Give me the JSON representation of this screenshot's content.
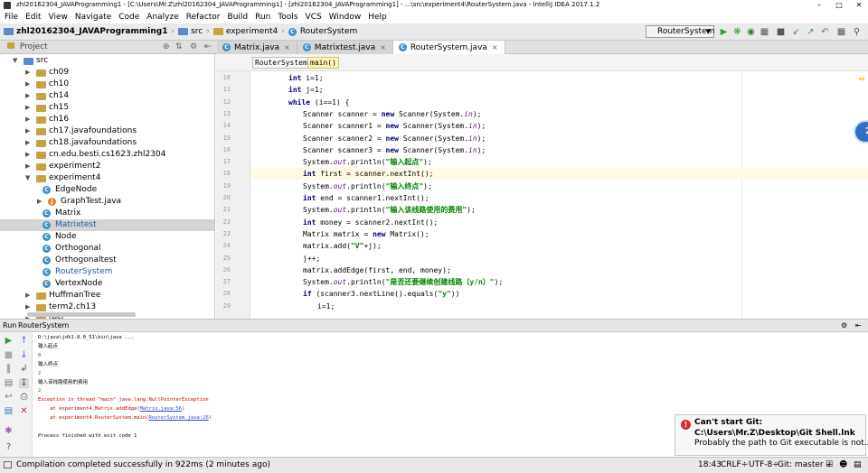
{
  "window": {
    "title": "zhl20162304_JAVAProgramming1 - [C:\\Users\\Mr.Z\\zhl20162304_JAVAProgramming1] - [zhl20162304_JAVAProgramming1] - ...\\src\\experiment4\\RouterSystem.java - IntelliJ IDEA 2017.1.2"
  },
  "menu": [
    "File",
    "Edit",
    "View",
    "Navigate",
    "Code",
    "Analyze",
    "Refactor",
    "Build",
    "Run",
    "Tools",
    "VCS",
    "Window",
    "Help"
  ],
  "breadcrumb": {
    "project": "zhl20162304_JAVAProgramming1",
    "src": "src",
    "pkg": "experiment4",
    "file": "RouterSystem"
  },
  "run_config": "RouterSystem",
  "project_panel": {
    "header": "Project",
    "tree": [
      {
        "label": "src",
        "level": 0,
        "expanded": true,
        "kind": "folder"
      },
      {
        "label": "ch09",
        "level": 1,
        "expanded": false,
        "kind": "folder"
      },
      {
        "label": "ch10",
        "level": 1,
        "expanded": false,
        "kind": "folder"
      },
      {
        "label": "ch14",
        "level": 1,
        "expanded": false,
        "kind": "folder"
      },
      {
        "label": "ch15",
        "level": 1,
        "expanded": false,
        "kind": "folder"
      },
      {
        "label": "ch16",
        "level": 1,
        "expanded": false,
        "kind": "folder"
      },
      {
        "label": "ch17.javafoundations",
        "level": 1,
        "expanded": false,
        "kind": "folder"
      },
      {
        "label": "ch18.javafoundations",
        "level": 1,
        "expanded": false,
        "kind": "folder"
      },
      {
        "label": "cn.edu.besti.cs1623.zhl2304",
        "level": 1,
        "expanded": false,
        "kind": "folder"
      },
      {
        "label": "experiment2",
        "level": 1,
        "expanded": false,
        "kind": "folder"
      },
      {
        "label": "experiment4",
        "level": 1,
        "expanded": true,
        "kind": "folder"
      },
      {
        "label": "EdgeNode",
        "level": 2,
        "kind": "class"
      },
      {
        "label": "GraphTest.java",
        "level": 2,
        "kind": "java",
        "collapsible": true
      },
      {
        "label": "Matrix",
        "level": 2,
        "kind": "class"
      },
      {
        "label": "Matrixtest",
        "level": 2,
        "kind": "class",
        "selected": true,
        "blue": true
      },
      {
        "label": "Node",
        "level": 2,
        "kind": "class"
      },
      {
        "label": "Orthogonal",
        "level": 2,
        "kind": "class"
      },
      {
        "label": "Orthogonaltest",
        "level": 2,
        "kind": "class"
      },
      {
        "label": "RouterSystem",
        "level": 2,
        "kind": "class",
        "blue": true
      },
      {
        "label": "VertexNode",
        "level": 2,
        "kind": "class"
      },
      {
        "label": "HuffmanTree",
        "level": 1,
        "expanded": false,
        "kind": "folder"
      },
      {
        "label": "term2.ch13",
        "level": 1,
        "expanded": false,
        "kind": "folder"
      },
      {
        "label": "test",
        "level": 1,
        "expanded": false,
        "kind": "folder"
      }
    ]
  },
  "editor_tabs": [
    {
      "label": "Matrix.java",
      "active": false
    },
    {
      "label": "Matrixtest.java",
      "active": false
    },
    {
      "label": "RouterSystem.java",
      "active": true
    }
  ],
  "editor_crumbs": [
    "RouterSystem",
    "main()"
  ],
  "code_lines": [
    {
      "n": "10",
      "indent": 5,
      "tokens": [
        [
          "kw",
          "int"
        ],
        [
          "t",
          " i=1;"
        ]
      ]
    },
    {
      "n": "11",
      "indent": 5,
      "tokens": [
        [
          "kw",
          "int"
        ],
        [
          "t",
          " j=1;"
        ]
      ]
    },
    {
      "n": "12",
      "indent": 5,
      "tokens": [
        [
          "kw",
          "while"
        ],
        [
          "t",
          " (i==1) {"
        ]
      ]
    },
    {
      "n": "13",
      "indent": 7,
      "tokens": [
        [
          "t",
          "Scanner scanner = "
        ],
        [
          "kw",
          "new"
        ],
        [
          "t",
          " Scanner(System."
        ],
        [
          "fi",
          "in"
        ],
        [
          "t",
          ");"
        ]
      ]
    },
    {
      "n": "14",
      "indent": 7,
      "tokens": [
        [
          "t",
          "Scanner scanner1 = "
        ],
        [
          "kw",
          "new"
        ],
        [
          "t",
          " Scanner(System."
        ],
        [
          "fi",
          "in"
        ],
        [
          "t",
          ");"
        ]
      ]
    },
    {
      "n": "15",
      "indent": 7,
      "tokens": [
        [
          "t",
          "Scanner scanner2 = "
        ],
        [
          "kw",
          "new"
        ],
        [
          "t",
          " Scanner(System."
        ],
        [
          "fi",
          "in"
        ],
        [
          "t",
          ");"
        ]
      ]
    },
    {
      "n": "16",
      "indent": 7,
      "tokens": [
        [
          "t",
          "Scanner scanner3 = "
        ],
        [
          "kw",
          "new"
        ],
        [
          "t",
          " Scanner(System."
        ],
        [
          "fi",
          "in"
        ],
        [
          "t",
          ");"
        ]
      ]
    },
    {
      "n": "17",
      "indent": 7,
      "tokens": [
        [
          "t",
          "System."
        ],
        [
          "fi",
          "out"
        ],
        [
          "t",
          ".println("
        ],
        [
          "st",
          "\"输入起点\""
        ],
        [
          "t",
          ");"
        ]
      ]
    },
    {
      "n": "18",
      "indent": 7,
      "current": true,
      "tokens": [
        [
          "kw",
          "int"
        ],
        [
          "t",
          " first = scanner.nextInt();"
        ]
      ]
    },
    {
      "n": "19",
      "indent": 7,
      "tokens": [
        [
          "t",
          "System."
        ],
        [
          "fi",
          "out"
        ],
        [
          "t",
          ".println("
        ],
        [
          "st",
          "\"输入终点\""
        ],
        [
          "t",
          ");"
        ]
      ]
    },
    {
      "n": "20",
      "indent": 7,
      "tokens": [
        [
          "kw",
          "int"
        ],
        [
          "t",
          " end = scanner1.nextInt();"
        ]
      ]
    },
    {
      "n": "21",
      "indent": 7,
      "tokens": [
        [
          "t",
          "System."
        ],
        [
          "fi",
          "out"
        ],
        [
          "t",
          ".println("
        ],
        [
          "st",
          "\"输入该线路使用的费用\""
        ],
        [
          "t",
          ");"
        ]
      ]
    },
    {
      "n": "22",
      "indent": 7,
      "tokens": [
        [
          "kw",
          "int"
        ],
        [
          "t",
          " money = scanner2.nextInt();"
        ]
      ]
    },
    {
      "n": "23",
      "indent": 7,
      "tokens": [
        [
          "t",
          "Matrix matrix = "
        ],
        [
          "kw",
          "new"
        ],
        [
          "t",
          " Matrix();"
        ]
      ]
    },
    {
      "n": "24",
      "indent": 7,
      "tokens": [
        [
          "t",
          "matrix.add("
        ],
        [
          "st",
          "\"V\""
        ],
        [
          "t",
          "+j);"
        ]
      ]
    },
    {
      "n": "25",
      "indent": 7,
      "tokens": [
        [
          "t",
          "j++;"
        ]
      ]
    },
    {
      "n": "26",
      "indent": 7,
      "tokens": [
        [
          "t",
          "matrix.addEdge(first, end, money);"
        ]
      ]
    },
    {
      "n": "27",
      "indent": 7,
      "tokens": [
        [
          "t",
          "System."
        ],
        [
          "fi",
          "out"
        ],
        [
          "t",
          ".println("
        ],
        [
          "st",
          "\"是否还要继续创建线路（y/n）\""
        ],
        [
          "t",
          ");"
        ]
      ]
    },
    {
      "n": "28",
      "indent": 7,
      "tokens": [
        [
          "kw",
          "if"
        ],
        [
          "t",
          " (scanner3.nextLine().equals("
        ],
        [
          "st",
          "\"y\""
        ],
        [
          "t",
          "))"
        ]
      ]
    },
    {
      "n": "29",
      "indent": 9,
      "tokens": [
        [
          "t",
          "i=1;"
        ]
      ]
    }
  ],
  "run_panel": {
    "title": "Run",
    "config": "RouterSystem"
  },
  "console": [
    {
      "type": "normal",
      "text": "D:\\java\\jdk1.8.0_51\\bin\\java ..."
    },
    {
      "type": "normal",
      "text": "输入起点"
    },
    {
      "type": "in",
      "text": "0"
    },
    {
      "type": "normal",
      "text": "输入终点"
    },
    {
      "type": "in",
      "text": "2"
    },
    {
      "type": "normal",
      "text": "输入该线路使用的费用"
    },
    {
      "type": "in",
      "text": "2"
    },
    {
      "type": "err",
      "text": "Exception in thread \"main\" java.lang.NullPointerException"
    },
    {
      "type": "err",
      "text": "    at experiment4.Matrix.addEdge(",
      "link": "Matrix.java:56",
      "after": ")"
    },
    {
      "type": "err",
      "text": "    at experiment4.RouterSystem.main(",
      "link": "RouterSystem.java:26",
      "after": ")"
    },
    {
      "type": "blank",
      "text": ""
    },
    {
      "type": "normal",
      "text": "Process finished with exit code 1"
    }
  ],
  "notification": {
    "title": "Can't start Git:",
    "path": "C:\\Users\\Mr.Z\\Desktop\\Git Shell.lnk",
    "message": "Probably the path to Git executable is not..."
  },
  "status": {
    "message": "Compilation completed successfully in 922ms (2 minutes ago)",
    "position": "18:43",
    "line_sep": "CRLF÷",
    "encoding": "UTF-8÷",
    "vcs": "Git: master ÷"
  },
  "colors": {
    "keyword": "#000080",
    "string": "#008000",
    "field": "#660e7a",
    "error": "#cc0000",
    "selection": "#d4d4d4"
  }
}
